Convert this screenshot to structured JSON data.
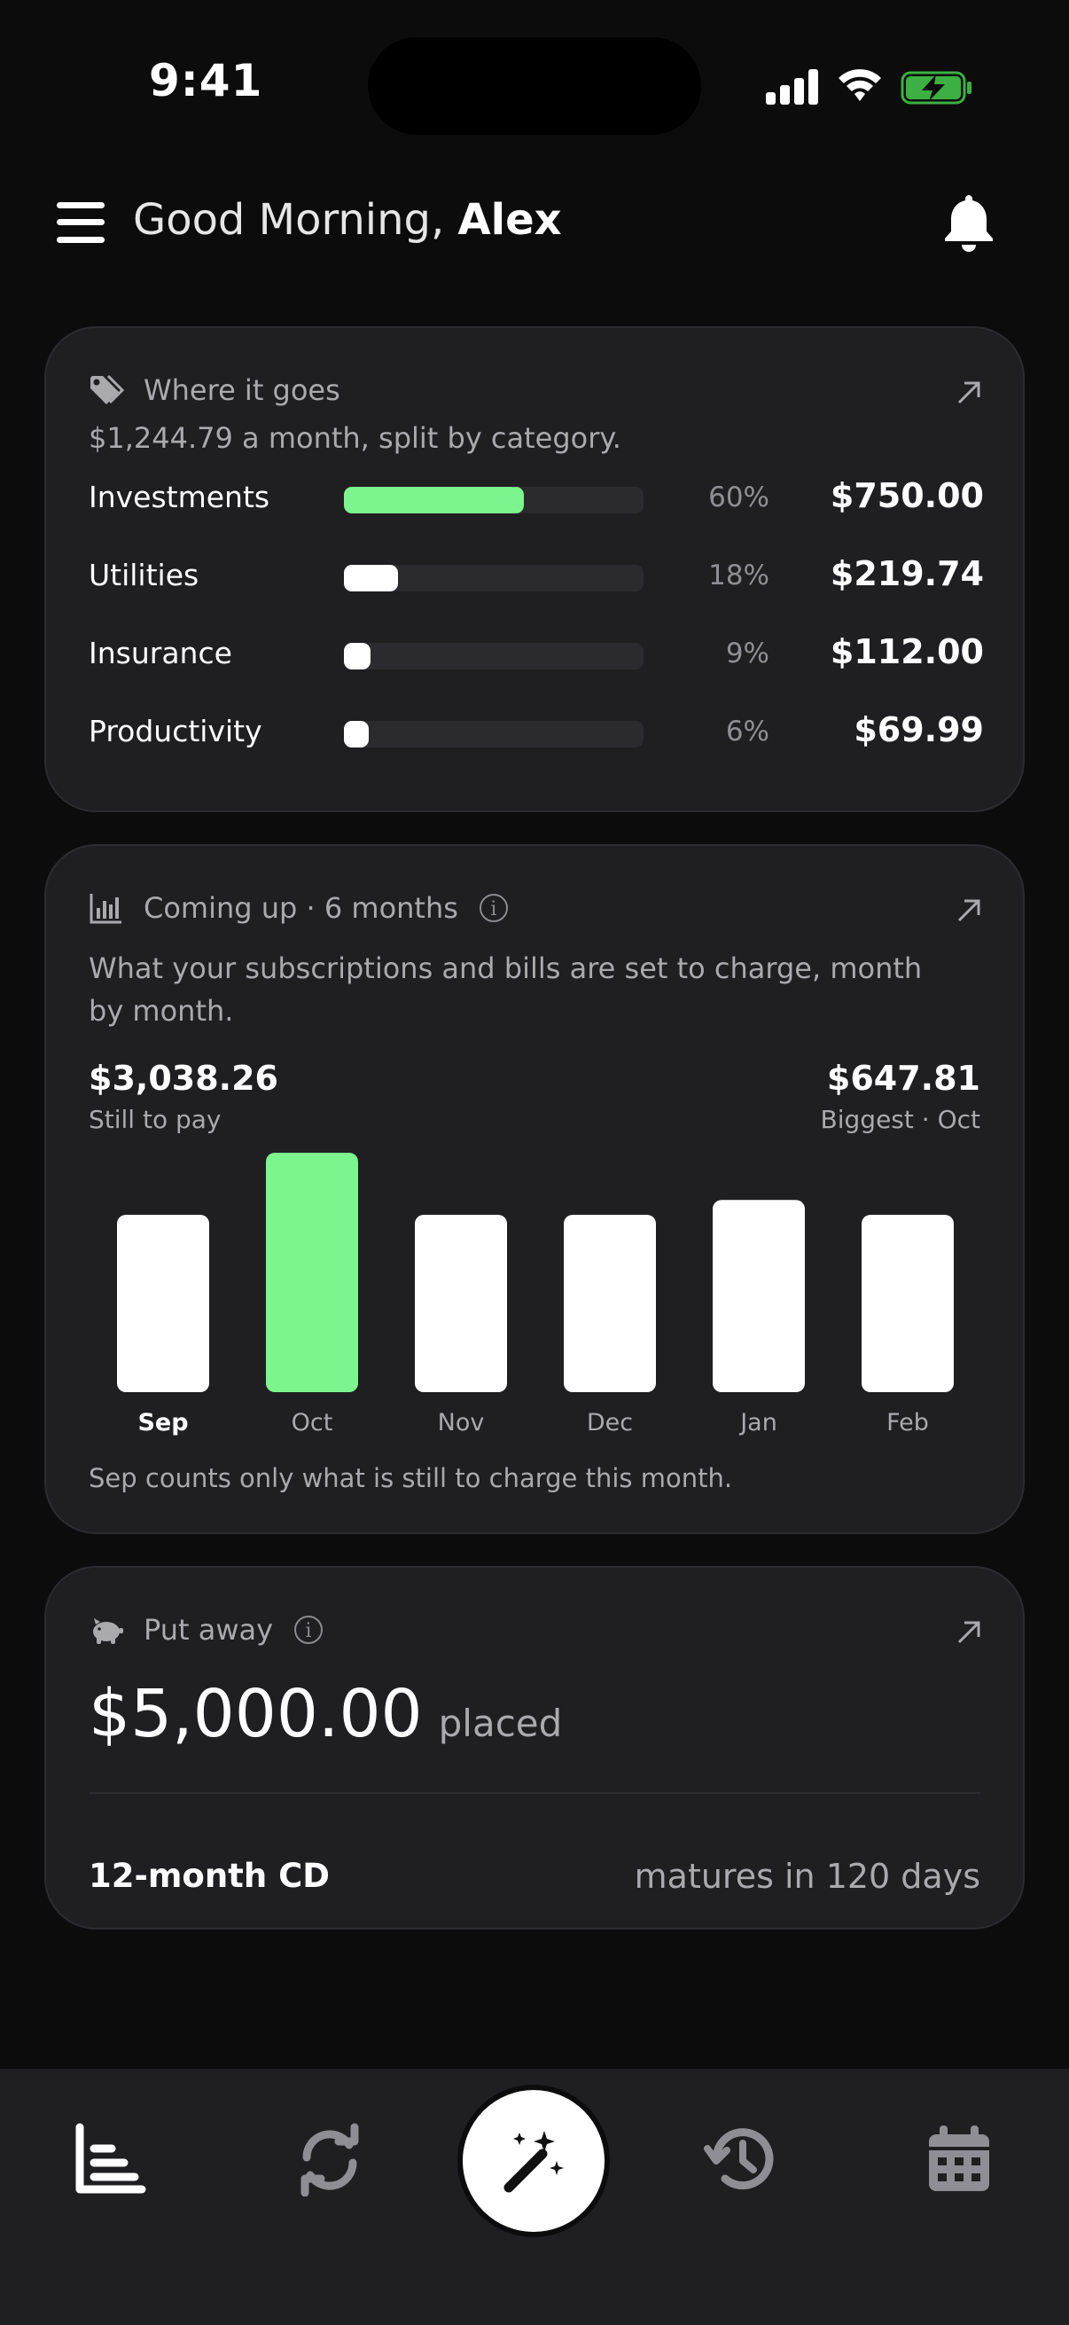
{
  "status_bar": {
    "time": "9:41"
  },
  "header": {
    "greeting": "Good Morning,",
    "name": "Alex"
  },
  "spending": {
    "title": "Where it goes",
    "subtitle": "$1,244.79 a month, split by category.",
    "categories": [
      {
        "name": "Investments",
        "percent": "60%",
        "amount": "$750.00",
        "fill": 0.6,
        "color": "#7cf58f"
      },
      {
        "name": "Utilities",
        "percent": "18%",
        "amount": "$219.74",
        "fill": 0.18,
        "color": "#ffffff"
      },
      {
        "name": "Insurance",
        "percent": "9%",
        "amount": "$112.00",
        "fill": 0.09,
        "color": "#ffffff"
      },
      {
        "name": "Productivity",
        "percent": "6%",
        "amount": "$69.99",
        "fill": 0.06,
        "color": "#ffffff"
      }
    ]
  },
  "upcoming": {
    "title": "Coming up · 6 months",
    "description": "What your subscriptions and bills are set to charge, month by month.",
    "total": "$3,038.26",
    "total_label": "Still to pay",
    "biggest": "$647.81",
    "biggest_label": "Biggest · Oct",
    "footnote": "Sep counts only what is still to charge this month."
  },
  "chart_data": {
    "type": "bar",
    "categories": [
      "Sep",
      "Oct",
      "Nov",
      "Dec",
      "Jan",
      "Feb"
    ],
    "values": [
      480,
      647.81,
      480,
      480,
      520,
      480
    ],
    "highlight": "Oct",
    "highlight_color": "#7cf58f",
    "bar_color": "#ffffff",
    "title": "",
    "xlabel": "",
    "ylabel": ""
  },
  "savings": {
    "title": "Put away",
    "amount": "$5,000.00",
    "amount_suffix": "placed",
    "product": "12-month CD",
    "maturity": "matures in 120 days"
  },
  "tabs": [
    "chart-icon",
    "refresh-icon",
    "magic-wand-icon",
    "history-icon",
    "calendar-icon"
  ],
  "colors": {
    "accent": "#7cf58f",
    "background": "#0c0c0d",
    "card": "#1f1f22"
  }
}
